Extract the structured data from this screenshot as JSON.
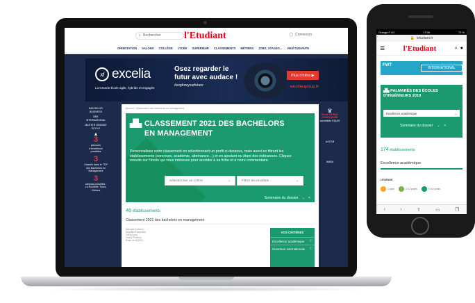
{
  "desktop": {
    "search_placeholder": "Rechercher",
    "logo": "l'Etudiant",
    "connexion": "Connexion",
    "nav": [
      "ORIENTATION",
      "SALONS",
      "COLLÈGE",
      "LYCÉE",
      "SUPÉRIEUR",
      "CLASSEMENTS",
      "MÉTIERS",
      "JOBS, STAGES...",
      "VIE ÉTUDIANTE"
    ],
    "banner": {
      "brand": "excelia",
      "tagline": "La Grande École agile, hybride et engagée",
      "headline": "Osez regarder le futur avec audace !",
      "hashtag": "#exploreyourfuture",
      "cta": "Plus d'infos ▶",
      "url": "excelia-group.fr"
    },
    "left_side": {
      "programs": [
        "BACHELOR BUSINESS",
        "BBA INTERNATIONAL",
        "MASTER GRANDE ÉCOLE"
      ],
      "stats": [
        {
          "num": "3",
          "text": "parcours d'excellence possibles"
        },
        {
          "num": "3",
          "text": "Classée dans le TOP des Bachelors en Management"
        },
        {
          "num": "3",
          "text": "campus possibles : La Rochelle, Tours, Orléans"
        }
      ]
    },
    "right_side": [
      "École TRIPLE COURONNÉE",
      "accréditée EQUIS",
      "AACSB",
      "AMBA"
    ],
    "breadcrumb": "Accueil / Classement des bachelors en management",
    "hero": {
      "title": "CLASSEMENT 2021 DES BACHELORS EN MANAGEMENT",
      "text": "Personnalisez votre classement en sélectionnant un profil ci-dessous, mais aussi en filtrant les établissements (concours, académie, alternance…) et en ajoutant ou ôtant des indicateurs. Cliquez ensuite sur l'école qui vous intéresse pour accéder à sa fiche et à notre commentaire.",
      "select1": "Sélectionner un critère",
      "select2": "Filtrer les résultats",
      "sommaire": "Sommaire du dossier"
    },
    "count_num": "40",
    "count_label": "établissements",
    "subtitle": "Classement 2021 des bachelors en management",
    "mini_list": [
      "Allongée (Lanoux)",
      "(Signaled Dauphine)",
      "Lioxy (Lyon)",
      "Paris (+Poitiers)",
      "Poste de 40/2021"
    ],
    "criteria_title": "VOS CRITÈRES",
    "criteria": [
      "Excellence académique",
      "Ouverture internationale"
    ]
  },
  "phone": {
    "status_left": "Orange F  4G",
    "status_time": "17:06",
    "status_right": "72 %",
    "url": "letudiant.fr",
    "logo": "l'Etudiant",
    "banner_left": "FWT",
    "banner_right": "INTERNATIONAL",
    "hero_title": "PALMARÈS DES ÉCOLES D'INGÉNIEURS 2019",
    "hero_select": "Excellence académique",
    "sommaire": "Sommaire du dossier",
    "count_num": "174",
    "count_label": "établissements",
    "section": "Excellence académique",
    "legend_title": "LÉGENDE",
    "legend": [
      {
        "label": "1 point",
        "color": "#f5a623"
      },
      {
        "label": "2 à 3 points",
        "color": "#7cb342"
      },
      {
        "label": "4 à 5 points",
        "color": "#1a9a6e"
      }
    ]
  }
}
